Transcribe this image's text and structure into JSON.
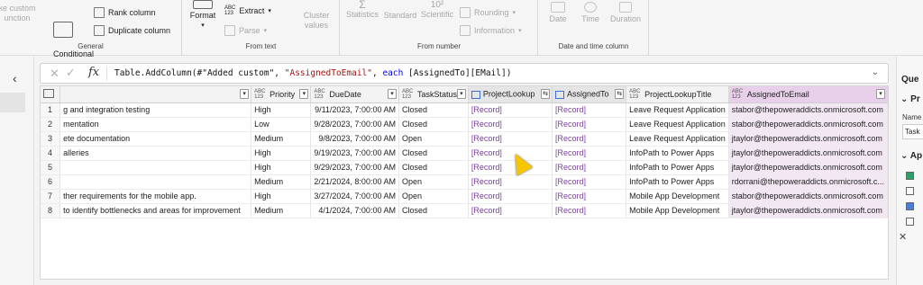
{
  "ribbon": {
    "groups": {
      "general": {
        "label": "General",
        "items": {
          "invoke_custom": "ke custom\nunction",
          "conditional_column": "Conditional\ncolumn",
          "rank_column": "Rank column",
          "duplicate_column": "Duplicate column"
        }
      },
      "from_text": {
        "label": "From text",
        "items": {
          "format": "Format",
          "extract": "Extract",
          "parse": "Parse",
          "cluster_values": "Cluster\nvalues"
        }
      },
      "from_number": {
        "label": "From number",
        "items": {
          "statistics": "Statistics",
          "standard": "Standard",
          "scientific": "Scientific",
          "rounding": "Rounding",
          "information": "Information"
        }
      },
      "date_time": {
        "label": "Date and time column",
        "items": {
          "date": "Date",
          "time": "Time",
          "duration": "Duration"
        }
      }
    }
  },
  "formula": {
    "prefix": "Table.AddColumn(#\"Added custom\", ",
    "arg": "\"AssignedToEmail\"",
    "sep": ", ",
    "each": "each",
    "suffix": " [AssignedTo][EMail])"
  },
  "grid": {
    "columns": [
      {
        "type": "",
        "label": ""
      },
      {
        "type": "ABC\n123",
        "label": "Priority"
      },
      {
        "type": "ABC\n123",
        "label": "DueDate"
      },
      {
        "type": "ABC\n123",
        "label": "TaskStatus"
      },
      {
        "type": "",
        "label": "ProjectLookup"
      },
      {
        "type": "",
        "label": "AssignedTo"
      },
      {
        "type": "ABC\n123",
        "label": "ProjectLookupTitle"
      },
      {
        "type": "ABC\n123",
        "label": "AssignedToEmail"
      }
    ],
    "rows": [
      {
        "n": "1",
        "title": "g and integration testing",
        "priority": "High",
        "due": "9/11/2023, 7:00:00 AM",
        "status": "Closed",
        "pl": "[Record]",
        "at": "[Record]",
        "plt": "Leave Request Application",
        "email": "stabor@thepoweraddicts.onmicrosoft.com"
      },
      {
        "n": "2",
        "title": "mentation",
        "priority": "Low",
        "due": "9/28/2023, 7:00:00 AM",
        "status": "Closed",
        "pl": "[Record]",
        "at": "[Record]",
        "plt": "Leave Request Application",
        "email": "stabor@thepoweraddicts.onmicrosoft.com"
      },
      {
        "n": "3",
        "title": "ete documentation",
        "priority": "Medium",
        "due": "9/8/2023, 7:00:00 AM",
        "status": "Open",
        "pl": "[Record]",
        "at": "[Record]",
        "plt": "Leave Request Application",
        "email": "jtaylor@thepoweraddicts.onmicrosoft.com"
      },
      {
        "n": "4",
        "title": "alleries",
        "priority": "High",
        "due": "9/19/2023, 7:00:00 AM",
        "status": "Closed",
        "pl": "[Record]",
        "at": "[Record]",
        "plt": "InfoPath to Power Apps",
        "email": "jtaylor@thepoweraddicts.onmicrosoft.com"
      },
      {
        "n": "5",
        "title": "",
        "priority": "High",
        "due": "9/29/2023, 7:00:00 AM",
        "status": "Closed",
        "pl": "[Record]",
        "at": "[Record]",
        "plt": "InfoPath to Power Apps",
        "email": "jtaylor@thepoweraddicts.onmicrosoft.com"
      },
      {
        "n": "6",
        "title": "",
        "priority": "Medium",
        "due": "2/21/2024, 8:00:00 AM",
        "status": "Open",
        "pl": "[Record]",
        "at": "[Record]",
        "plt": "InfoPath to Power Apps",
        "email": "rdorrani@thepoweraddicts.onmicrosoft.c..."
      },
      {
        "n": "7",
        "title": "ther requirements for the mobile app.",
        "priority": "High",
        "due": "3/27/2024, 7:00:00 AM",
        "status": "Open",
        "pl": "[Record]",
        "at": "[Record]",
        "plt": "Mobile App Development",
        "email": "stabor@thepoweraddicts.onmicrosoft.com"
      },
      {
        "n": "8",
        "title": "to identify bottlenecks and areas for improvement",
        "priority": "Medium",
        "due": "4/1/2024, 7:00:00 AM",
        "status": "Closed",
        "pl": "[Record]",
        "at": "[Record]",
        "plt": "Mobile App Development",
        "email": "jtaylor@thepoweraddicts.onmicrosoft.com"
      }
    ]
  },
  "right_pane": {
    "title": "Que",
    "props_title": "Pr",
    "name_label": "Name",
    "name_value": "Task",
    "applied_title": "Ap"
  },
  "colors": {
    "selected_header": "#e8d0ea",
    "record_link": "#7a3fa0"
  }
}
